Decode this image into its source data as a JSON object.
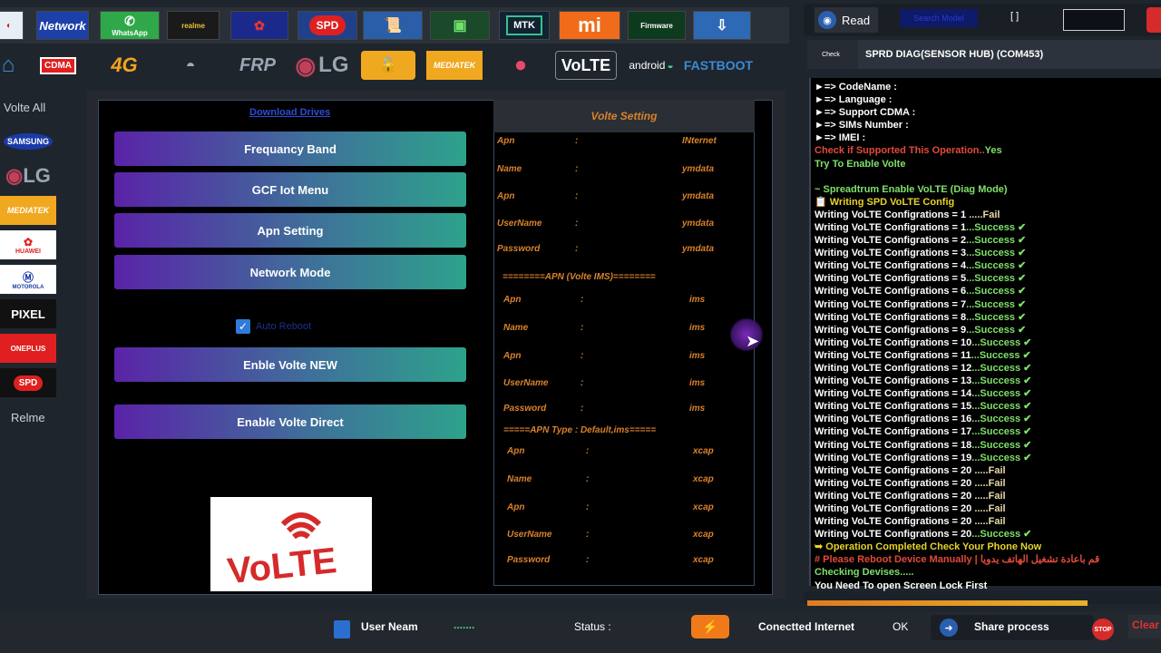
{
  "top_strip": {
    "items": [
      {
        "label": "",
        "icon": "app-icon"
      },
      {
        "label": "Network",
        "icon": "network-icon"
      },
      {
        "label": "WhatsApp",
        "icon": "whatsapp-icon"
      },
      {
        "label": "realme",
        "icon": "realme-icon"
      },
      {
        "label": "",
        "icon": "huawei-icon"
      },
      {
        "label": "SPD",
        "icon": "spd-icon"
      },
      {
        "label": "",
        "icon": "certificate-icon"
      },
      {
        "label": "",
        "icon": "sim-icon"
      },
      {
        "label": "MTK",
        "icon": "mtk-icon"
      },
      {
        "label": "mi",
        "icon": "xiaomi-icon"
      },
      {
        "label": "Firmware",
        "icon": "firmware-icon"
      },
      {
        "label": "",
        "icon": "download-icon"
      }
    ]
  },
  "brand_row": {
    "items": [
      {
        "label": "",
        "icon": "home-icon"
      },
      {
        "label": "CDMA",
        "icon": "cdma-icon"
      },
      {
        "label": "4G",
        "icon": "4g-icon"
      },
      {
        "label": "",
        "icon": "router-icon"
      },
      {
        "label": "FRP",
        "icon": "frp-icon"
      },
      {
        "label": "LG",
        "icon": "lg-icon"
      },
      {
        "label": "",
        "icon": "lock-icon"
      },
      {
        "label": "MEDIATEK",
        "icon": "mediatek-icon"
      },
      {
        "label": "",
        "icon": "apple-icon"
      },
      {
        "label": "VoLTE",
        "icon": "volte-icon"
      },
      {
        "label": "android",
        "icon": "android-icon"
      },
      {
        "label": "FASTBOOT",
        "icon": "fastboot-icon"
      }
    ]
  },
  "left_column": {
    "title": "Volte All",
    "items": [
      "SAMSUNG",
      "LG",
      "MEDIATEK",
      "HUAWEI",
      "MOTOROLA",
      "PIXEL",
      "ONEPLUS",
      "SPD"
    ],
    "footer": "Relme"
  },
  "center": {
    "download_link": "Download Drives",
    "buttons": [
      "Frequancy Band",
      "GCF Iot Menu",
      "Apn Setting",
      "Network Mode"
    ],
    "checkbox_label": "Auto Reboot",
    "buttons2": [
      "Enble Volte NEW",
      "Enable Volte Direct"
    ],
    "logo_text": "VoLTE"
  },
  "volte_setting": {
    "title": "Volte Setting",
    "group1": [
      {
        "key": "Apn",
        "sep": ":",
        "val": "INternet"
      },
      {
        "key": "Name",
        "sep": ":",
        "val": "ymdata"
      },
      {
        "key": "Apn",
        "sep": ":",
        "val": "ymdata"
      },
      {
        "key": "UserName",
        "sep": ":",
        "val": "ymdata"
      },
      {
        "key": "Password",
        "sep": ":",
        "val": "ymdata"
      }
    ],
    "section2": "========APN (Volte IMS)========",
    "group2": [
      {
        "key": "Apn",
        "sep": ":",
        "val": "ims"
      },
      {
        "key": "Name",
        "sep": ":",
        "val": "ims"
      },
      {
        "key": "Apn",
        "sep": ":",
        "val": "ims"
      },
      {
        "key": "UserName",
        "sep": ":",
        "val": "ims"
      },
      {
        "key": "Password",
        "sep": ":",
        "val": "ims"
      }
    ],
    "section3": "=====APN Type  : Default,ims=====",
    "group3": [
      {
        "key": "Apn",
        "sep": ":",
        "val": "xcap"
      },
      {
        "key": "Name",
        "sep": ":",
        "val": "xcap"
      },
      {
        "key": "Apn",
        "sep": ":",
        "val": "xcap"
      },
      {
        "key": "UserName",
        "sep": ":",
        "val": "xcap"
      },
      {
        "key": "Password",
        "sep": ":",
        "val": "xcap"
      }
    ]
  },
  "right_panel": {
    "read_label": "Read",
    "blue_box_label": "Search Model",
    "bracket": "[ ]",
    "check_label": "Check",
    "device": "SPRD DIAG(SENSOR HUB) (COM453)"
  },
  "log_lines": [
    {
      "text": "►=> CodeName :",
      "tail": "",
      "color": "#ffffff"
    },
    {
      "text": "►=> Language :",
      "tail": "",
      "color": "#ffffff"
    },
    {
      "text": "►=> Support CDMA :",
      "tail": "",
      "color": "#ffffff"
    },
    {
      "text": "►=> SIMs Number :",
      "tail": "",
      "color": "#ffffff"
    },
    {
      "text": "►=> IMEI :",
      "tail": "",
      "color": "#ffffff"
    },
    {
      "text": "Check if Supported This Operation..",
      "tail": "Yes",
      "color": "#e24a3b",
      "tailcolor": "#7fe06a"
    },
    {
      "text": "Try To Enable Volte",
      "tail": "",
      "color": "#7fe06a"
    },
    {
      "text": "",
      "tail": "",
      "color": "#ffffff"
    },
    {
      "text": "~ Spreadtrum Enable VoLTE (Diag Mode)",
      "tail": "",
      "color": "#7fe06a"
    },
    {
      "text": "📋 Writing SPD VoLTE Config",
      "tail": "",
      "color": "#e6d32a"
    },
    {
      "text": "Writing VoLTE Configrations = 1",
      "tail": " .....Fail",
      "color": "#ffffff",
      "tailcolor": "#e6d9a8"
    },
    {
      "text": "Writing VoLTE Configrations = 1",
      "tail": "...Success ✔",
      "color": "#ffffff",
      "tailcolor": "#7fe06a"
    },
    {
      "text": "Writing VoLTE Configrations = 2",
      "tail": "...Success ✔",
      "color": "#ffffff",
      "tailcolor": "#7fe06a"
    },
    {
      "text": "Writing VoLTE Configrations = 3",
      "tail": "...Success ✔",
      "color": "#ffffff",
      "tailcolor": "#7fe06a"
    },
    {
      "text": "Writing VoLTE Configrations = 4",
      "tail": "...Success ✔",
      "color": "#ffffff",
      "tailcolor": "#7fe06a"
    },
    {
      "text": "Writing VoLTE Configrations = 5",
      "tail": "...Success ✔",
      "color": "#ffffff",
      "tailcolor": "#7fe06a"
    },
    {
      "text": "Writing VoLTE Configrations = 6",
      "tail": "...Success ✔",
      "color": "#ffffff",
      "tailcolor": "#7fe06a"
    },
    {
      "text": "Writing VoLTE Configrations = 7",
      "tail": "...Success ✔",
      "color": "#ffffff",
      "tailcolor": "#7fe06a"
    },
    {
      "text": "Writing VoLTE Configrations = 8",
      "tail": "...Success ✔",
      "color": "#ffffff",
      "tailcolor": "#7fe06a"
    },
    {
      "text": "Writing VoLTE Configrations = 9",
      "tail": "...Success ✔",
      "color": "#ffffff",
      "tailcolor": "#7fe06a"
    },
    {
      "text": "Writing VoLTE Configrations = 10",
      "tail": "...Success ✔",
      "color": "#ffffff",
      "tailcolor": "#7fe06a"
    },
    {
      "text": "Writing VoLTE Configrations = 11",
      "tail": "...Success ✔",
      "color": "#ffffff",
      "tailcolor": "#7fe06a"
    },
    {
      "text": "Writing VoLTE Configrations = 12",
      "tail": "...Success ✔",
      "color": "#ffffff",
      "tailcolor": "#7fe06a"
    },
    {
      "text": "Writing VoLTE Configrations = 13",
      "tail": "...Success ✔",
      "color": "#ffffff",
      "tailcolor": "#7fe06a"
    },
    {
      "text": "Writing VoLTE Configrations = 14",
      "tail": "...Success ✔",
      "color": "#ffffff",
      "tailcolor": "#7fe06a"
    },
    {
      "text": "Writing VoLTE Configrations = 15",
      "tail": "...Success ✔",
      "color": "#ffffff",
      "tailcolor": "#7fe06a"
    },
    {
      "text": "Writing VoLTE Configrations = 16",
      "tail": "...Success ✔",
      "color": "#ffffff",
      "tailcolor": "#7fe06a"
    },
    {
      "text": "Writing VoLTE Configrations = 17",
      "tail": "...Success ✔",
      "color": "#ffffff",
      "tailcolor": "#7fe06a"
    },
    {
      "text": "Writing VoLTE Configrations = 18",
      "tail": "...Success ✔",
      "color": "#ffffff",
      "tailcolor": "#7fe06a"
    },
    {
      "text": "Writing VoLTE Configrations = 19",
      "tail": "...Success ✔",
      "color": "#ffffff",
      "tailcolor": "#7fe06a"
    },
    {
      "text": "Writing VoLTE Configrations = 20",
      "tail": " .....Fail",
      "color": "#ffffff",
      "tailcolor": "#e6d9a8"
    },
    {
      "text": "Writing VoLTE Configrations = 20",
      "tail": " .....Fail",
      "color": "#ffffff",
      "tailcolor": "#e6d9a8"
    },
    {
      "text": "Writing VoLTE Configrations = 20",
      "tail": " .....Fail",
      "color": "#ffffff",
      "tailcolor": "#e6d9a8"
    },
    {
      "text": "Writing VoLTE Configrations = 20",
      "tail": " .....Fail",
      "color": "#ffffff",
      "tailcolor": "#e6d9a8"
    },
    {
      "text": "Writing VoLTE Configrations = 20",
      "tail": " .....Fail",
      "color": "#ffffff",
      "tailcolor": "#e6d9a8"
    },
    {
      "text": "Writing VoLTE Configrations = 20",
      "tail": "...Success ✔",
      "color": "#ffffff",
      "tailcolor": "#7fe06a"
    },
    {
      "text": "➥ Operation Completed Check Your Phone Now",
      "tail": "",
      "color": "#e6d32a"
    },
    {
      "text": "# Please Reboot Device Manually | قم باعادة تشغيل الهاتف يدويا",
      "tail": "",
      "color": "#e24a3b"
    },
    {
      "text": "Checking Devises.....",
      "tail": "",
      "color": "#7fe06a"
    },
    {
      "text": "You Need To open Screen Lock First",
      "tail": "",
      "color": "#ffffff"
    }
  ],
  "progress": {
    "value": 0.8
  },
  "status_bar": {
    "user": "User Neam",
    "dots": ".......",
    "status_label": "Status :",
    "connection": "Conectted Internet",
    "ok": "OK",
    "share": "Share process",
    "clear": "Clear"
  },
  "colors": {
    "accent_orange": "#d9822b",
    "log_green": "#7fe06a",
    "log_red": "#e24a3b",
    "log_yellow": "#e6d32a"
  }
}
